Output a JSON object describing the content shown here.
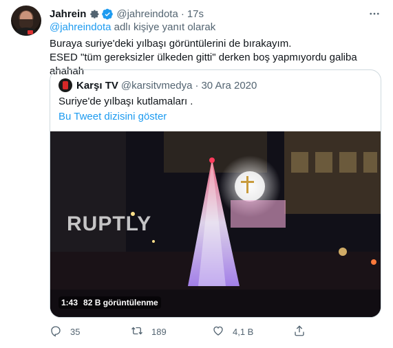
{
  "tweet": {
    "author_name": "Jahrein",
    "author_handle": "@jahreindota",
    "separator": "·",
    "time": "17s",
    "reply_prefix": "@jahreindota",
    "reply_suffix": " adlı kişiye yanıt olarak",
    "text_line1": "Buraya suriye'deki yılbaşı görüntülerini de bırakayım.",
    "text_line2": "ESED \"tüm gereksizler ülkeden gitti\" derken boş yapmıyordu galiba ahahah"
  },
  "quote": {
    "author_name": "Karşı TV",
    "author_handle": "@karsitvmedya",
    "separator": "·",
    "date": "30 Ara 2020",
    "text": "Suriye'de yılbaşı kutlamaları .",
    "show_thread": "Bu Tweet dizisini göster",
    "video": {
      "watermark": "RUPTLY",
      "duration": "1:43",
      "views": "82 B görüntülenme"
    }
  },
  "actions": {
    "reply_count": "35",
    "retweet_count": "189",
    "like_count": "4,1 B",
    "share_count": ""
  },
  "icons": {
    "more": "more-horizontal-icon",
    "gear": "gear-icon",
    "verified": "verified-badge-icon",
    "reply": "reply-icon",
    "retweet": "retweet-icon",
    "like": "heart-icon",
    "share": "share-icon"
  },
  "colors": {
    "accent": "#1d9bf0",
    "secondary_text": "#536471",
    "border": "#cfd9de"
  }
}
